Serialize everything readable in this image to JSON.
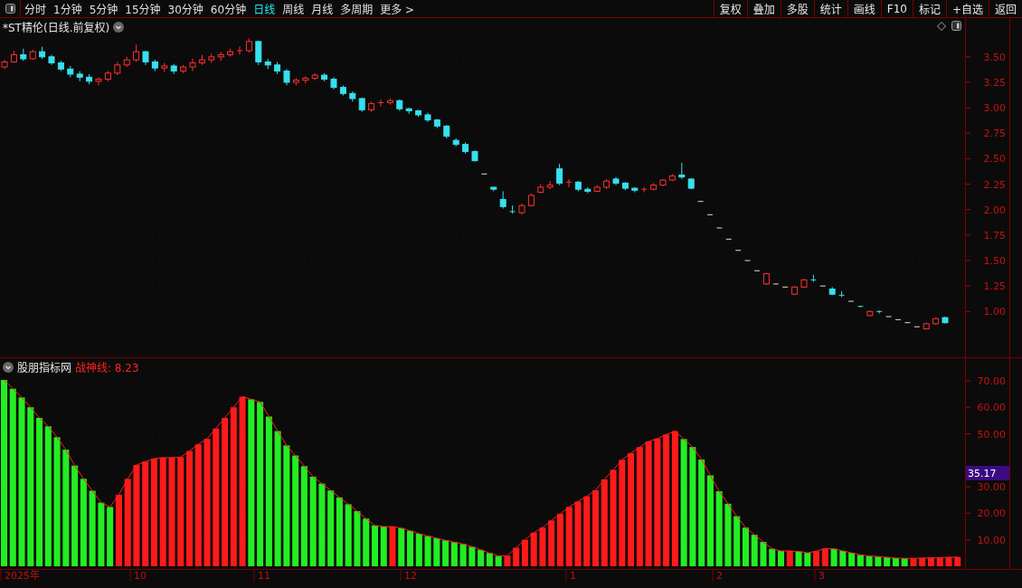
{
  "toolbar": {
    "periods": [
      {
        "label": "分时",
        "selected": false
      },
      {
        "label": "1分钟",
        "selected": false
      },
      {
        "label": "5分钟",
        "selected": false
      },
      {
        "label": "15分钟",
        "selected": false
      },
      {
        "label": "30分钟",
        "selected": false
      },
      {
        "label": "60分钟",
        "selected": false
      },
      {
        "label": "日线",
        "selected": true
      },
      {
        "label": "周线",
        "selected": false
      },
      {
        "label": "月线",
        "selected": false
      },
      {
        "label": "多周期",
        "selected": false
      },
      {
        "label": "更多 >",
        "selected": false
      }
    ],
    "actions": [
      "复权",
      "叠加",
      "多股",
      "统计",
      "画线",
      "F10",
      "标记",
      "+自选",
      "返回"
    ]
  },
  "price_panel": {
    "title": "*ST精伦(日线.前复权)",
    "chart_data": {
      "type": "candlestick",
      "ylim": [
        0.55,
        3.88
      ],
      "grid": true,
      "yticks": [
        {
          "value": 3.5,
          "label": "3.50"
        },
        {
          "value": 3.25,
          "label": "3.25"
        },
        {
          "value": 3.0,
          "label": "3.00"
        },
        {
          "value": 2.75,
          "label": "2.75"
        },
        {
          "value": 2.5,
          "label": "2.50"
        },
        {
          "value": 2.25,
          "label": "2.25"
        },
        {
          "value": 2.0,
          "label": "2.00"
        },
        {
          "value": 1.75,
          "label": "1.75"
        },
        {
          "value": 1.5,
          "label": "1.50"
        },
        {
          "value": 1.25,
          "label": "1.25"
        },
        {
          "value": 1.0,
          "label": "1.00"
        }
      ],
      "ohlc": [
        [
          3.4,
          3.47,
          3.38,
          3.45
        ],
        [
          3.45,
          3.56,
          3.44,
          3.52
        ],
        [
          3.52,
          3.58,
          3.46,
          3.48
        ],
        [
          3.48,
          3.57,
          3.47,
          3.55
        ],
        [
          3.55,
          3.6,
          3.48,
          3.5
        ],
        [
          3.5,
          3.52,
          3.42,
          3.44
        ],
        [
          3.44,
          3.46,
          3.36,
          3.38
        ],
        [
          3.38,
          3.41,
          3.3,
          3.33
        ],
        [
          3.33,
          3.36,
          3.26,
          3.3
        ],
        [
          3.3,
          3.33,
          3.23,
          3.26
        ],
        [
          3.26,
          3.3,
          3.22,
          3.28
        ],
        [
          3.28,
          3.36,
          3.26,
          3.34
        ],
        [
          3.34,
          3.45,
          3.32,
          3.42
        ],
        [
          3.42,
          3.5,
          3.4,
          3.47
        ],
        [
          3.47,
          3.62,
          3.45,
          3.55
        ],
        [
          3.55,
          3.56,
          3.42,
          3.45
        ],
        [
          3.45,
          3.47,
          3.36,
          3.39
        ],
        [
          3.39,
          3.44,
          3.35,
          3.41
        ],
        [
          3.41,
          3.43,
          3.33,
          3.36
        ],
        [
          3.36,
          3.42,
          3.34,
          3.4
        ],
        [
          3.4,
          3.48,
          3.36,
          3.44
        ],
        [
          3.44,
          3.52,
          3.42,
          3.47
        ],
        [
          3.47,
          3.53,
          3.44,
          3.5
        ],
        [
          3.5,
          3.55,
          3.46,
          3.52
        ],
        [
          3.52,
          3.58,
          3.5,
          3.55
        ],
        [
          3.55,
          3.6,
          3.52,
          3.56
        ],
        [
          3.56,
          3.68,
          3.54,
          3.65
        ],
        [
          3.65,
          3.66,
          3.42,
          3.45
        ],
        [
          3.45,
          3.48,
          3.38,
          3.42
        ],
        [
          3.42,
          3.45,
          3.33,
          3.36
        ],
        [
          3.36,
          3.38,
          3.22,
          3.25
        ],
        [
          3.25,
          3.29,
          3.22,
          3.27
        ],
        [
          3.27,
          3.31,
          3.24,
          3.29
        ],
        [
          3.29,
          3.34,
          3.27,
          3.32
        ],
        [
          3.32,
          3.34,
          3.26,
          3.28
        ],
        [
          3.28,
          3.3,
          3.18,
          3.2
        ],
        [
          3.2,
          3.22,
          3.12,
          3.14
        ],
        [
          3.14,
          3.16,
          3.06,
          3.09
        ],
        [
          3.09,
          3.1,
          2.96,
          2.98
        ],
        [
          2.98,
          3.06,
          2.96,
          3.04
        ],
        [
          3.04,
          3.08,
          3.01,
          3.05
        ],
        [
          3.05,
          3.09,
          3.03,
          3.07
        ],
        [
          3.07,
          3.08,
          2.97,
          2.99
        ],
        [
          2.99,
          3.0,
          2.94,
          2.97
        ],
        [
          2.97,
          2.98,
          2.91,
          2.93
        ],
        [
          2.93,
          2.95,
          2.86,
          2.88
        ],
        [
          2.88,
          2.89,
          2.8,
          2.82
        ],
        [
          2.82,
          2.83,
          2.7,
          2.72
        ],
        [
          2.68,
          2.7,
          2.62,
          2.64
        ],
        [
          2.64,
          2.66,
          2.55,
          2.57
        ],
        [
          2.57,
          2.58,
          2.47,
          2.48
        ],
        [
          2.35,
          2.35,
          2.35,
          2.35
        ],
        [
          2.22,
          2.22,
          2.18,
          2.2
        ],
        [
          2.1,
          2.18,
          2.01,
          2.03
        ],
        [
          1.98,
          2.04,
          1.96,
          1.97
        ],
        [
          1.97,
          2.06,
          1.95,
          2.04
        ],
        [
          2.04,
          2.16,
          2.03,
          2.14
        ],
        [
          2.17,
          2.25,
          2.16,
          2.22
        ],
        [
          2.22,
          2.28,
          2.2,
          2.24
        ],
        [
          2.4,
          2.45,
          2.24,
          2.26
        ],
        [
          2.26,
          2.3,
          2.22,
          2.27
        ],
        [
          2.27,
          2.28,
          2.18,
          2.2
        ],
        [
          2.2,
          2.22,
          2.16,
          2.18
        ],
        [
          2.18,
          2.24,
          2.17,
          2.22
        ],
        [
          2.22,
          2.3,
          2.2,
          2.28
        ],
        [
          2.3,
          2.32,
          2.24,
          2.26
        ],
        [
          2.26,
          2.27,
          2.19,
          2.21
        ],
        [
          2.21,
          2.22,
          2.17,
          2.19
        ],
        [
          2.19,
          2.22,
          2.17,
          2.2
        ],
        [
          2.2,
          2.26,
          2.19,
          2.24
        ],
        [
          2.24,
          2.3,
          2.23,
          2.29
        ],
        [
          2.29,
          2.35,
          2.28,
          2.33
        ],
        [
          2.34,
          2.46,
          2.3,
          2.32
        ],
        [
          2.3,
          2.31,
          2.2,
          2.21
        ],
        [
          2.08,
          2.08,
          2.08,
          2.08
        ],
        [
          1.95,
          1.95,
          1.95,
          1.95
        ],
        [
          1.82,
          1.82,
          1.82,
          1.82
        ],
        [
          1.71,
          1.71,
          1.71,
          1.71
        ],
        [
          1.6,
          1.6,
          1.6,
          1.6
        ],
        [
          1.5,
          1.5,
          1.5,
          1.5
        ],
        [
          1.4,
          1.4,
          1.4,
          1.4
        ],
        [
          1.27,
          1.38,
          1.26,
          1.37
        ],
        [
          1.27,
          1.27,
          1.27,
          1.27
        ],
        [
          1.24,
          1.24,
          1.24,
          1.24
        ],
        [
          1.17,
          1.25,
          1.16,
          1.24
        ],
        [
          1.24,
          1.32,
          1.23,
          1.31
        ],
        [
          1.31,
          1.36,
          1.29,
          1.3
        ],
        [
          1.25,
          1.25,
          1.25,
          1.25
        ],
        [
          1.22,
          1.24,
          1.16,
          1.17
        ],
        [
          1.16,
          1.2,
          1.14,
          1.15
        ],
        [
          1.1,
          1.1,
          1.1,
          1.1
        ],
        [
          1.05,
          1.05,
          1.04,
          1.04
        ],
        [
          0.96,
          1.01,
          0.95,
          1.0
        ],
        [
          1.0,
          1.01,
          0.98,
          0.99
        ],
        [
          0.95,
          0.95,
          0.95,
          0.95
        ],
        [
          0.92,
          0.92,
          0.92,
          0.92
        ],
        [
          0.89,
          0.89,
          0.89,
          0.89
        ],
        [
          0.85,
          0.85,
          0.85,
          0.85
        ],
        [
          0.83,
          0.89,
          0.82,
          0.88
        ],
        [
          0.88,
          0.94,
          0.87,
          0.93
        ],
        [
          0.94,
          0.95,
          0.88,
          0.89
        ]
      ]
    }
  },
  "indicator_panel": {
    "name": "股朋指标网",
    "line_label": "战神线: 8.23",
    "current_value": "35.17",
    "chart_data": {
      "type": "bar",
      "grid": true,
      "ylim": [
        0,
        78.5
      ],
      "yticks": [
        {
          "value": 70,
          "label": "70.00"
        },
        {
          "value": 60,
          "label": "60.00"
        },
        {
          "value": 50,
          "label": "50.00"
        },
        {
          "value": 30,
          "label": "30.00"
        },
        {
          "value": 20,
          "label": "20.00"
        },
        {
          "value": 10,
          "label": "10.00"
        }
      ],
      "series": [
        {
          "color": "#ff1a1a",
          "values": [
            null,
            null,
            null,
            null,
            null,
            null,
            null,
            null,
            null,
            null,
            null,
            null,
            null,
            27,
            33,
            38.2,
            39.5,
            40.6,
            41,
            41,
            41.2,
            43.5,
            46,
            48.1,
            52,
            56,
            60,
            64,
            null,
            null,
            null,
            null,
            null,
            null,
            null,
            null,
            null,
            null,
            null,
            null,
            null,
            null,
            null,
            null,
            15,
            null,
            null,
            null,
            null,
            null,
            null,
            null,
            null,
            null,
            null,
            null,
            null,
            4,
            7,
            10,
            12.7,
            14.6,
            17.3,
            19.8,
            22.4,
            24.4,
            26.4,
            28.7,
            32.8,
            36.4,
            40.2,
            42.7,
            45,
            47.1,
            48.2,
            49.7,
            51,
            null,
            null,
            null,
            null,
            null,
            null,
            null,
            null,
            null,
            null,
            null,
            null,
            5.8,
            null,
            null,
            5.7,
            6.7,
            null,
            null,
            null,
            null,
            null,
            null,
            null,
            null,
            null,
            3,
            3.1,
            3.2,
            3.3,
            3.4,
            3.5
          ]
        },
        {
          "color": "#22ee22",
          "values": [
            70.3,
            67,
            63.7,
            60,
            56,
            52.8,
            48.7,
            44,
            38,
            33,
            28.5,
            24,
            22.4,
            null,
            null,
            null,
            null,
            null,
            null,
            null,
            null,
            null,
            null,
            null,
            null,
            null,
            null,
            null,
            63,
            62,
            56.5,
            51,
            45.6,
            41.8,
            37.8,
            33.8,
            31.2,
            28.6,
            26,
            23.4,
            20.8,
            18,
            15.4,
            15,
            null,
            14.4,
            13.4,
            12.3,
            11.4,
            10.6,
            9.8,
            9.1,
            8.4,
            7.4,
            6.2,
            5,
            3.9,
            null,
            null,
            null,
            null,
            null,
            null,
            null,
            null,
            null,
            null,
            null,
            null,
            null,
            null,
            null,
            null,
            null,
            null,
            null,
            null,
            48,
            45,
            40.3,
            34.3,
            28.3,
            23.6,
            18.9,
            14.6,
            11.9,
            9.2,
            6.6,
            5.8,
            null,
            5.6,
            5.1,
            null,
            null,
            6.6,
            5.8,
            5.1,
            4.3,
            3.9,
            3.7,
            3.4,
            3.1,
            3,
            null,
            null,
            null,
            null,
            null,
            null
          ]
        },
        {
          "type": "line",
          "color": "#ff2020",
          "values": [
            70.3,
            67,
            63.7,
            60,
            56,
            52.8,
            48.7,
            44,
            38,
            33,
            28.5,
            24,
            22.4,
            27,
            33,
            38.2,
            39.5,
            40.6,
            41,
            41,
            41.2,
            43.5,
            46,
            48.1,
            52,
            56,
            60,
            64,
            63,
            62,
            56.5,
            51,
            45.6,
            41.8,
            37.8,
            33.8,
            31.2,
            28.6,
            26,
            23.4,
            20.8,
            18,
            15.4,
            15,
            15,
            14.4,
            13.4,
            12.3,
            11.4,
            10.6,
            9.8,
            9.1,
            8.4,
            7.4,
            6.2,
            5,
            3.9,
            4,
            7,
            10,
            12.7,
            14.6,
            17.3,
            19.8,
            22.4,
            24.4,
            26.4,
            28.7,
            32.8,
            36.4,
            40.2,
            42.7,
            45,
            47.1,
            48.2,
            49.7,
            51,
            48,
            45,
            40.3,
            34.3,
            28.3,
            23.6,
            18.9,
            14.6,
            11.9,
            9.2,
            6.6,
            5.8,
            5.8,
            5.6,
            5.1,
            5.7,
            6.7,
            6.6,
            5.8,
            5.1,
            4.3,
            3.9,
            3.7,
            3.4,
            3.1,
            3,
            3,
            3.1,
            3.2,
            3.3,
            3.4,
            3.5
          ]
        }
      ]
    }
  },
  "date_axis": [
    "2025年",
    "10",
    "11",
    "12",
    "1",
    "2",
    "3"
  ]
}
